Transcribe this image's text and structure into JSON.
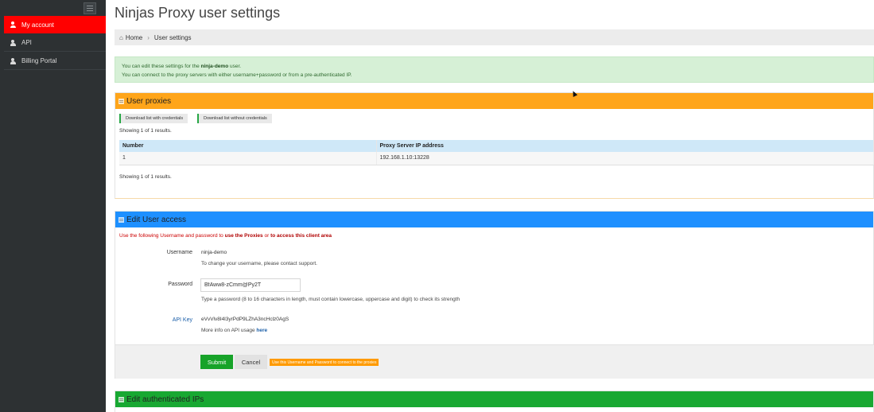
{
  "sidebar": {
    "items": [
      {
        "label": "My account",
        "icon": "user-icon"
      },
      {
        "label": "API",
        "icon": "user-icon"
      },
      {
        "label": "Billing Portal",
        "icon": "user-icon"
      }
    ],
    "active_color": "#ff0000"
  },
  "page": {
    "title": "Ninjas Proxy user settings"
  },
  "breadcrumb": {
    "home": "Home",
    "current": "User settings"
  },
  "alert": {
    "line1_prefix": "You can edit these settings for the ",
    "line1_user": "ninja-demo",
    "line1_suffix": " user.",
    "line2": "You can connect to the proxy servers with either username+password or from a pre-authenticated IP."
  },
  "user_proxies": {
    "title": "User proxies",
    "header_color": "#ffa51a",
    "download_with_credentials": "Download list with credentials",
    "download_without_credentials": "Download list without credentials",
    "summary_top": "Showing 1 of 1 results.",
    "summary_bottom": "Showing 1 of 1 results.",
    "columns": [
      "Number",
      "Proxy Server IP address"
    ],
    "rows": [
      {
        "number": "1",
        "ip": "192.168.1.10:13228"
      }
    ]
  },
  "user_access": {
    "title": "Edit User access",
    "header_color": "#1e90ff",
    "intro_prefix": "Use the following Username and password to ",
    "intro_bold1": "use the Proxies",
    "intro_mid": " or ",
    "intro_bold2": "to access this client area",
    "username_label": "Username",
    "username_value": "ninja-demo",
    "username_help": "To change your username, please contact support.",
    "password_label": "Password",
    "password_value": "BfAww8-zCmm@Py2T",
    "password_help": "Type a password (8 to 16 characters in length, must contain lowercase, uppercase and digit) to check its strength",
    "api_key_label": "API Key",
    "api_key_value": "eVvVlv8I4l3yrPdP9LZhA3ncHclz0AgS",
    "api_help_prefix": "More info on API usage ",
    "api_help_link": "here",
    "submit_label": "Submit",
    "cancel_label": "Cancel",
    "hint_badge": "Use this Username and Password to connect to the proxies"
  },
  "authenticated_ips": {
    "title": "Edit authenticated IPs",
    "header_color": "#18a832"
  }
}
